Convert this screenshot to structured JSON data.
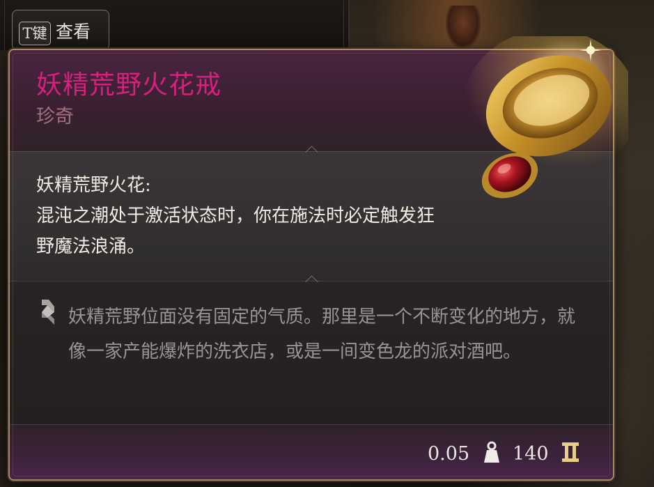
{
  "hint": {
    "key": "T键",
    "label": "查看"
  },
  "item": {
    "name": "妖精荒野火花戒",
    "rarity": "珍奇",
    "ability_title": "妖精荒野火花:",
    "ability_desc": "混沌之潮处于激活状态时，你在施法时必定触发狂野魔法浪涌。",
    "lore": "妖精荒野位面没有固定的气质。那里是一个不断变化的地方，就像一家产能爆炸的洗衣店，或是一间变色龙的派对酒吧。",
    "weight": "0.05",
    "value": "140"
  },
  "icons": {
    "item_image": "gold-ring-red-gem-icon",
    "lore": "quote-scroll-icon",
    "weight": "weight-icon",
    "value": "gold-coin-icon"
  },
  "colors": {
    "rarity_name": "#d6207d",
    "rarity_label": "#a2707e",
    "border": "#a88a5e",
    "lore_text": "#9c9493"
  }
}
